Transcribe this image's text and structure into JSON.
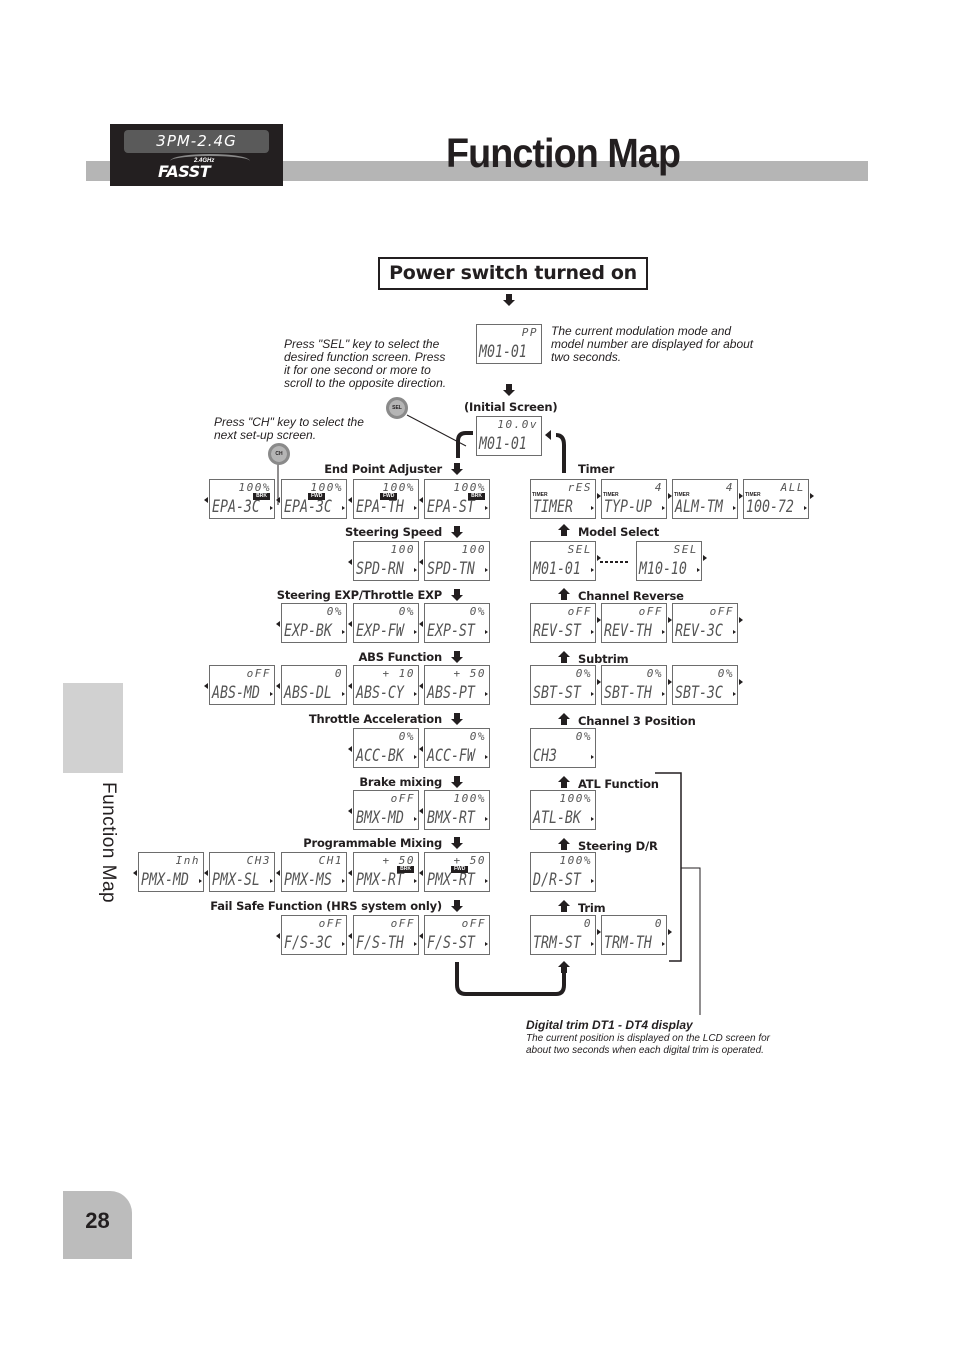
{
  "header": {
    "logo_model": "3PM-2.4G",
    "logo_brand": "FASST",
    "logo_band": "2.4GHz",
    "title": "Function Map"
  },
  "side_tab": {
    "label": "Function Map"
  },
  "page_number": "28",
  "power_on": {
    "label": "Power switch turned on",
    "startup_screen": {
      "top": "PP",
      "bottom": "M01-01"
    },
    "startup_note": "The current modulation mode and model number are displayed for about two seconds.",
    "initial_label": "(Initial Screen)",
    "initial_screen": {
      "top": "10.0v",
      "bottom": "M01-01"
    }
  },
  "notes": {
    "sel_key": "Press \"SEL\" key to select the desired function screen. Press it for one second or more to scroll to the opposite direction.",
    "ch_key": "Press \"CH\" key to select the next set-up screen.",
    "sel_button": "SEL",
    "ch_button": "CH"
  },
  "left_column": [
    {
      "name": "End Point Adjuster",
      "screens": [
        {
          "top": "100%",
          "bottom": "EPA-3C",
          "badge": "BRK"
        },
        {
          "top": "100%",
          "bottom": "EPA-3C",
          "badge": "FWD"
        },
        {
          "top": "100%",
          "bottom": "EPA-TH",
          "badge": "FWD"
        },
        {
          "top": "100%",
          "bottom": "EPA-ST",
          "badge": "BRK"
        }
      ]
    },
    {
      "name": "Steering Speed",
      "screens": [
        {
          "top": "100",
          "bottom": "SPD-RN"
        },
        {
          "top": "100",
          "bottom": "SPD-TN"
        }
      ]
    },
    {
      "name": "Steering EXP/Throttle EXP",
      "screens": [
        {
          "top": "0%",
          "bottom": "EXP-BK"
        },
        {
          "top": "0%",
          "bottom": "EXP-FW"
        },
        {
          "top": "0%",
          "bottom": "EXP-ST"
        }
      ]
    },
    {
      "name": "ABS Function",
      "screens": [
        {
          "top": "oFF",
          "bottom": "ABS-MD"
        },
        {
          "top": "0",
          "bottom": "ABS-DL"
        },
        {
          "top": "+ 10",
          "bottom": "ABS-CY"
        },
        {
          "top": "+ 50",
          "bottom": "ABS-PT"
        }
      ]
    },
    {
      "name": "Throttle Acceleration",
      "screens": [
        {
          "top": "0%",
          "bottom": "ACC-BK"
        },
        {
          "top": "0%",
          "bottom": "ACC-FW"
        }
      ]
    },
    {
      "name": "Brake mixing",
      "screens": [
        {
          "top": "oFF",
          "bottom": "BMX-MD"
        },
        {
          "top": "100%",
          "bottom": "BMX-RT"
        }
      ]
    },
    {
      "name": "Programmable Mixing",
      "screens": [
        {
          "top": "Inh",
          "bottom": "PMX-MD"
        },
        {
          "top": "CH3",
          "bottom": "PMX-SL"
        },
        {
          "top": "CH1",
          "bottom": "PMX-MS"
        },
        {
          "top": "+ 50",
          "bottom": "PMX-RT",
          "badge": "BRK"
        },
        {
          "top": "+ 50",
          "bottom": "PMX-RT",
          "badge": "FWD"
        }
      ]
    },
    {
      "name": "Fail Safe Function (HRS system only)",
      "screens": [
        {
          "top": "oFF",
          "bottom": "F/S-3C"
        },
        {
          "top": "oFF",
          "bottom": "F/S-TH"
        },
        {
          "top": "oFF",
          "bottom": "F/S-ST"
        }
      ]
    }
  ],
  "right_column": [
    {
      "name": "Timer",
      "timer_tag": "TIMER",
      "screens": [
        {
          "top": "rES",
          "bottom": "TIMER"
        },
        {
          "top": "4",
          "bottom": "TYP-UP"
        },
        {
          "top": "4",
          "bottom": "ALM-TM"
        },
        {
          "top": "ALL",
          "bottom": "100-72"
        }
      ]
    },
    {
      "name": "Model Select",
      "screens": [
        {
          "top": "SEL",
          "bottom": "M01-01"
        },
        {
          "top": "SEL",
          "bottom": "M10-10"
        }
      ]
    },
    {
      "name": "Channel Reverse",
      "screens": [
        {
          "top": "oFF",
          "bottom": "REV-ST"
        },
        {
          "top": "oFF",
          "bottom": "REV-TH"
        },
        {
          "top": "oFF",
          "bottom": "REV-3C"
        }
      ]
    },
    {
      "name": "Subtrim",
      "screens": [
        {
          "top": "0%",
          "bottom": "SBT-ST"
        },
        {
          "top": "0%",
          "bottom": "SBT-TH"
        },
        {
          "top": "0%",
          "bottom": "SBT-3C"
        }
      ]
    },
    {
      "name": "Channel 3 Position",
      "screens": [
        {
          "top": "0%",
          "bottom": "CH3"
        }
      ]
    },
    {
      "name": "ATL Function",
      "screens": [
        {
          "top": "100%",
          "bottom": "ATL-BK"
        }
      ]
    },
    {
      "name": "Steering D/R",
      "screens": [
        {
          "top": "100%",
          "bottom": "D/R-ST"
        }
      ]
    },
    {
      "name": "Trim",
      "screens": [
        {
          "top": "0",
          "bottom": "TRM-ST"
        },
        {
          "top": "0",
          "bottom": "TRM-TH"
        }
      ]
    }
  ],
  "digital_trim": {
    "title": "Digital trim DT1 - DT4 display",
    "description": "The current position is displayed on the LCD screen for about two seconds when each digital trim is operated."
  }
}
